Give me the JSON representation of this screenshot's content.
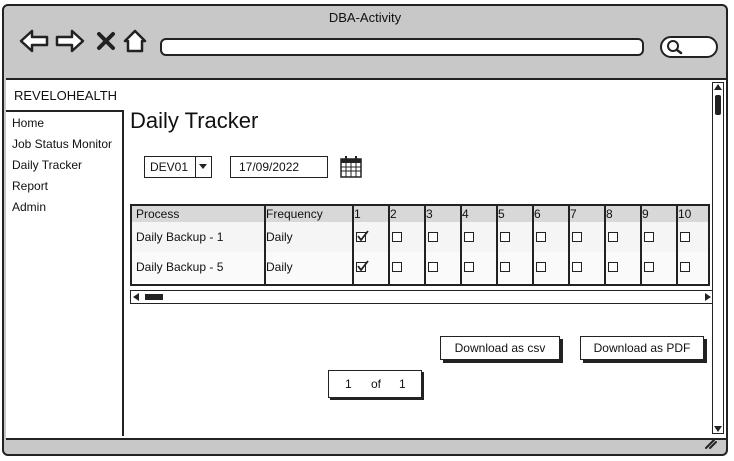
{
  "window": {
    "title": "DBA-Activity"
  },
  "app": {
    "brand": "REVELOHEALTH"
  },
  "sidebar": {
    "items": [
      {
        "label": "Home"
      },
      {
        "label": "Job Status Monitor"
      },
      {
        "label": "Daily Tracker"
      },
      {
        "label": "Report"
      },
      {
        "label": "Admin"
      }
    ]
  },
  "main": {
    "title": "Daily Tracker",
    "environment_select": {
      "value": "DEV01"
    },
    "date_field": {
      "value": "17/09/2022"
    }
  },
  "table": {
    "headers": [
      "Process",
      "Frequency",
      "1",
      "2",
      "3",
      "4",
      "5",
      "6",
      "7",
      "8",
      "9",
      "10"
    ],
    "rows": [
      {
        "process": "Daily Backup - 1",
        "frequency": "Daily",
        "checks": [
          true,
          false,
          false,
          false,
          false,
          false,
          false,
          false,
          false,
          false
        ]
      },
      {
        "process": "Daily Backup - 5",
        "frequency": "Daily",
        "checks": [
          true,
          false,
          false,
          false,
          false,
          false,
          false,
          false,
          false,
          false
        ]
      }
    ]
  },
  "actions": {
    "download_csv": "Download as csv",
    "download_pdf": "Download as PDF"
  },
  "pagination": {
    "current": "1",
    "of_label": "of",
    "total": "1"
  }
}
